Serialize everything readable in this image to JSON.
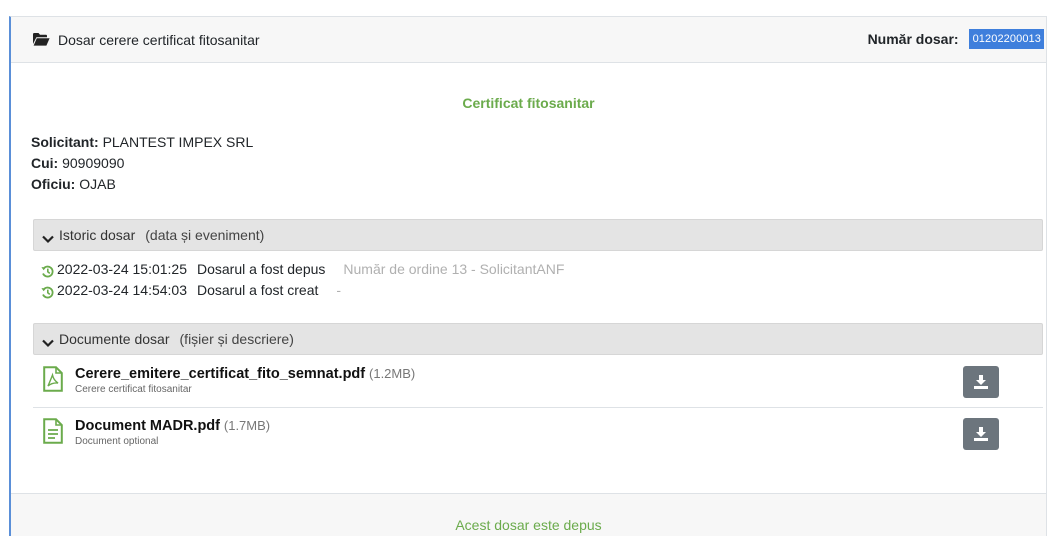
{
  "header": {
    "title": "Dosar cerere certificat fitosanitar",
    "dossier_label": "Număr dosar:",
    "dossier_number": "01202200013"
  },
  "section_title": "Certificat fitosanitar",
  "info": {
    "solicitant_label": "Solicitant:",
    "solicitant_value": "PLANTEST IMPEX SRL",
    "cui_label": "Cui:",
    "cui_value": "90909090",
    "oficiu_label": "Oficiu:",
    "oficiu_value": "OJAB"
  },
  "history": {
    "title": "Istoric dosar",
    "hint": "(data și eveniment)",
    "events": [
      {
        "datetime": "2022-03-24 15:01:25",
        "event": "Dosarul a fost depus",
        "extra": "Număr de ordine 13 - SolicitantANF"
      },
      {
        "datetime": "2022-03-24 14:54:03",
        "event": "Dosarul a fost creat",
        "extra": "-"
      }
    ]
  },
  "documents": {
    "title": "Documente dosar",
    "hint": "(fișier și descriere)",
    "items": [
      {
        "filename": "Cerere_emitere_certificat_fito_semnat.pdf",
        "size": "(1.2MB)",
        "description": "Cerere certificat fitosanitar",
        "icon": "pdf-file-icon"
      },
      {
        "filename": "Document MADR.pdf",
        "size": "(1.7MB)",
        "description": "Document optional",
        "icon": "text-file-icon"
      }
    ]
  },
  "footer": {
    "status": "Acest dosar este depus"
  },
  "colors": {
    "accent_green": "#6bab4c",
    "highlight_blue": "#3f7fdc",
    "button_gray": "#6c757d"
  }
}
